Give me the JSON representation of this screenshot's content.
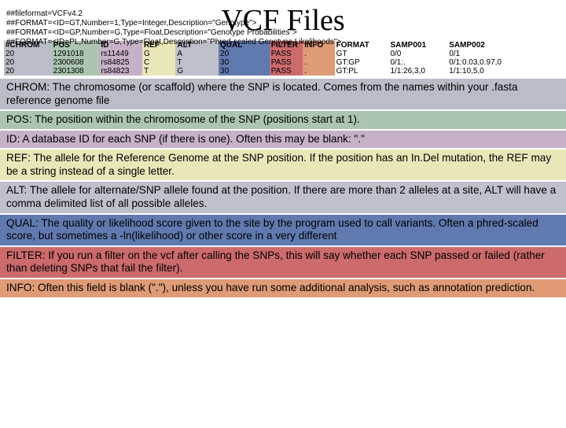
{
  "title": "VCF Files",
  "meta_lines": [
    "##fileformat=VCFv4.2",
    "##FORMAT=<ID=GT,Number=1,Type=Integer,Description=\"Genotype\">",
    "##FORMAT=<ID=GP,Number=G,Type=Float,Description=\"Genotype Probabilities\">",
    "##FORMAT=<ID=PL,Number=G,Type=Float,Description=\"Phred-scaled Genotype Likelihoods\">"
  ],
  "table": {
    "header": [
      "#CHROM",
      "POS",
      "ID",
      "REF",
      "ALT",
      "QUAL",
      "FILTER",
      "INFO",
      "FORMAT",
      "SAMP001",
      "SAMP002"
    ],
    "rows": [
      [
        "20",
        "1291018",
        "rs11449",
        "G",
        "A",
        "20",
        "PASS",
        ".",
        "GT",
        "0/0",
        "0/1"
      ],
      [
        "20",
        "2300608",
        "rs84825",
        "C",
        "T",
        "30",
        "PASS",
        ".",
        "GT:GP",
        "0/1:.",
        "0/1:0.03,0.97,0"
      ],
      [
        "20",
        "2301308",
        "rs84823",
        "T",
        "G",
        "30",
        "PASS",
        ".",
        "GT:PL",
        "1/1:26,3,0",
        "1/1:10,5,0"
      ]
    ]
  },
  "defs": [
    "CHROM: The chromosome (or scaffold) where the SNP is located. Comes from the names within your .fasta reference genome file",
    "POS: The position within the chromosome of the SNP (positions start at 1).",
    "ID: A database ID for each SNP (if there is one). Often this may be blank: \".\"",
    "REF: The allele for the Reference Genome at the SNP position. If the position has an In.Del mutation, the REF may be a string instead of a single letter.",
    "ALT: The allele for alternate/SNP allele found at the position. If there are more than 2 alleles at a site, ALT will have a comma delimited list of all possible alleles.",
    "QUAL: The quality or likelihood score given to the site by the program used to call variants. Often a phred-scaled score, but sometimes a -ln(likelihood) or other score in a very different",
    "FILTER: If you run a filter on the vcf after calling the SNPs, this will say whether each SNP passed or failed (rather than deleting SNPs that fail the filter).",
    "INFO: Often this field is blank (\".\"), unless you have run some additional analysis, such as annotation prediction."
  ]
}
